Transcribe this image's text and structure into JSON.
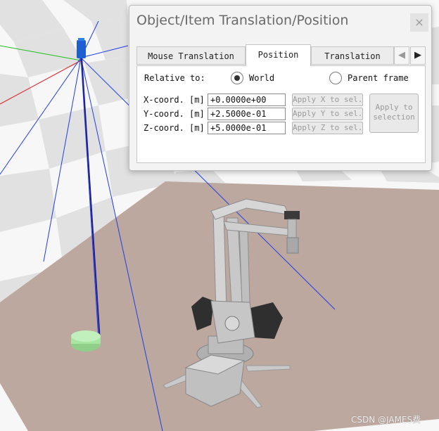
{
  "dialog": {
    "title": "Object/Item Translation/Position",
    "close_glyph": "×",
    "tabs": [
      {
        "label": "Mouse Translation",
        "active": false
      },
      {
        "label": "Position",
        "active": true
      },
      {
        "label": "Translation",
        "active": false
      }
    ],
    "tab_prev_glyph": "◀",
    "tab_next_glyph": "▶",
    "relative_to": {
      "label": "Relative to:",
      "options": [
        {
          "label": "World",
          "selected": true
        },
        {
          "label": "Parent frame",
          "selected": false
        }
      ]
    },
    "coords": [
      {
        "label": "X-coord. [m]",
        "value": "+0.0000e+00",
        "apply_label": "Apply X to sel."
      },
      {
        "label": "Y-coord. [m]",
        "value": "+2.5000e-01",
        "apply_label": "Apply Y to sel."
      },
      {
        "label": "Z-coord. [m]",
        "value": "+5.0000e-01",
        "apply_label": "Apply Z to sel."
      }
    ],
    "apply_to_selection_label": "Apply to selection"
  },
  "watermark": "CSDN @JAMES费",
  "colors": {
    "floor": "#bda89f",
    "grid_light": "#e4e4e4",
    "grid_white": "#f7f7f7",
    "sensor_lines": "#1e3ee6",
    "axis_red": "#e02020",
    "axis_green": "#20c020",
    "sensor_body": "#1f5fd1",
    "target_disk": "#a7e6a0"
  }
}
